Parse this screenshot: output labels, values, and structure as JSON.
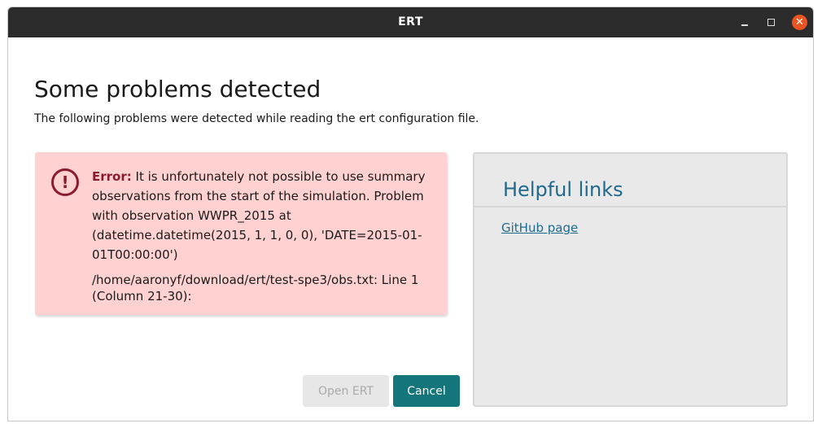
{
  "window": {
    "title": "ERT"
  },
  "header": {
    "title": "Some problems detected",
    "subtitle": "The following problems were detected while reading the ert configuration file."
  },
  "error": {
    "label": "Error:",
    "message": "It is unfortunately not possible to use summary observations from the start of the simulation. Problem with observation WWPR_2015 at (datetime.datetime(2015, 1, 1, 0, 0), 'DATE=2015-01-01T00:00:00')",
    "location": "/home/aaronyf/download/ert/test-spe3/obs.txt: Line 1 (Column 21-30):",
    "icon": "exclamation-circle-icon",
    "colors": {
      "background": "#ffd1d1",
      "accent": "#8b1a2d"
    }
  },
  "buttons": {
    "open_label": "Open ERT",
    "cancel_label": "Cancel",
    "cancel_color": "#14757b"
  },
  "help": {
    "title": "Helpful links",
    "links": [
      "GitHub page"
    ],
    "link_color": "#1f6a8c"
  }
}
